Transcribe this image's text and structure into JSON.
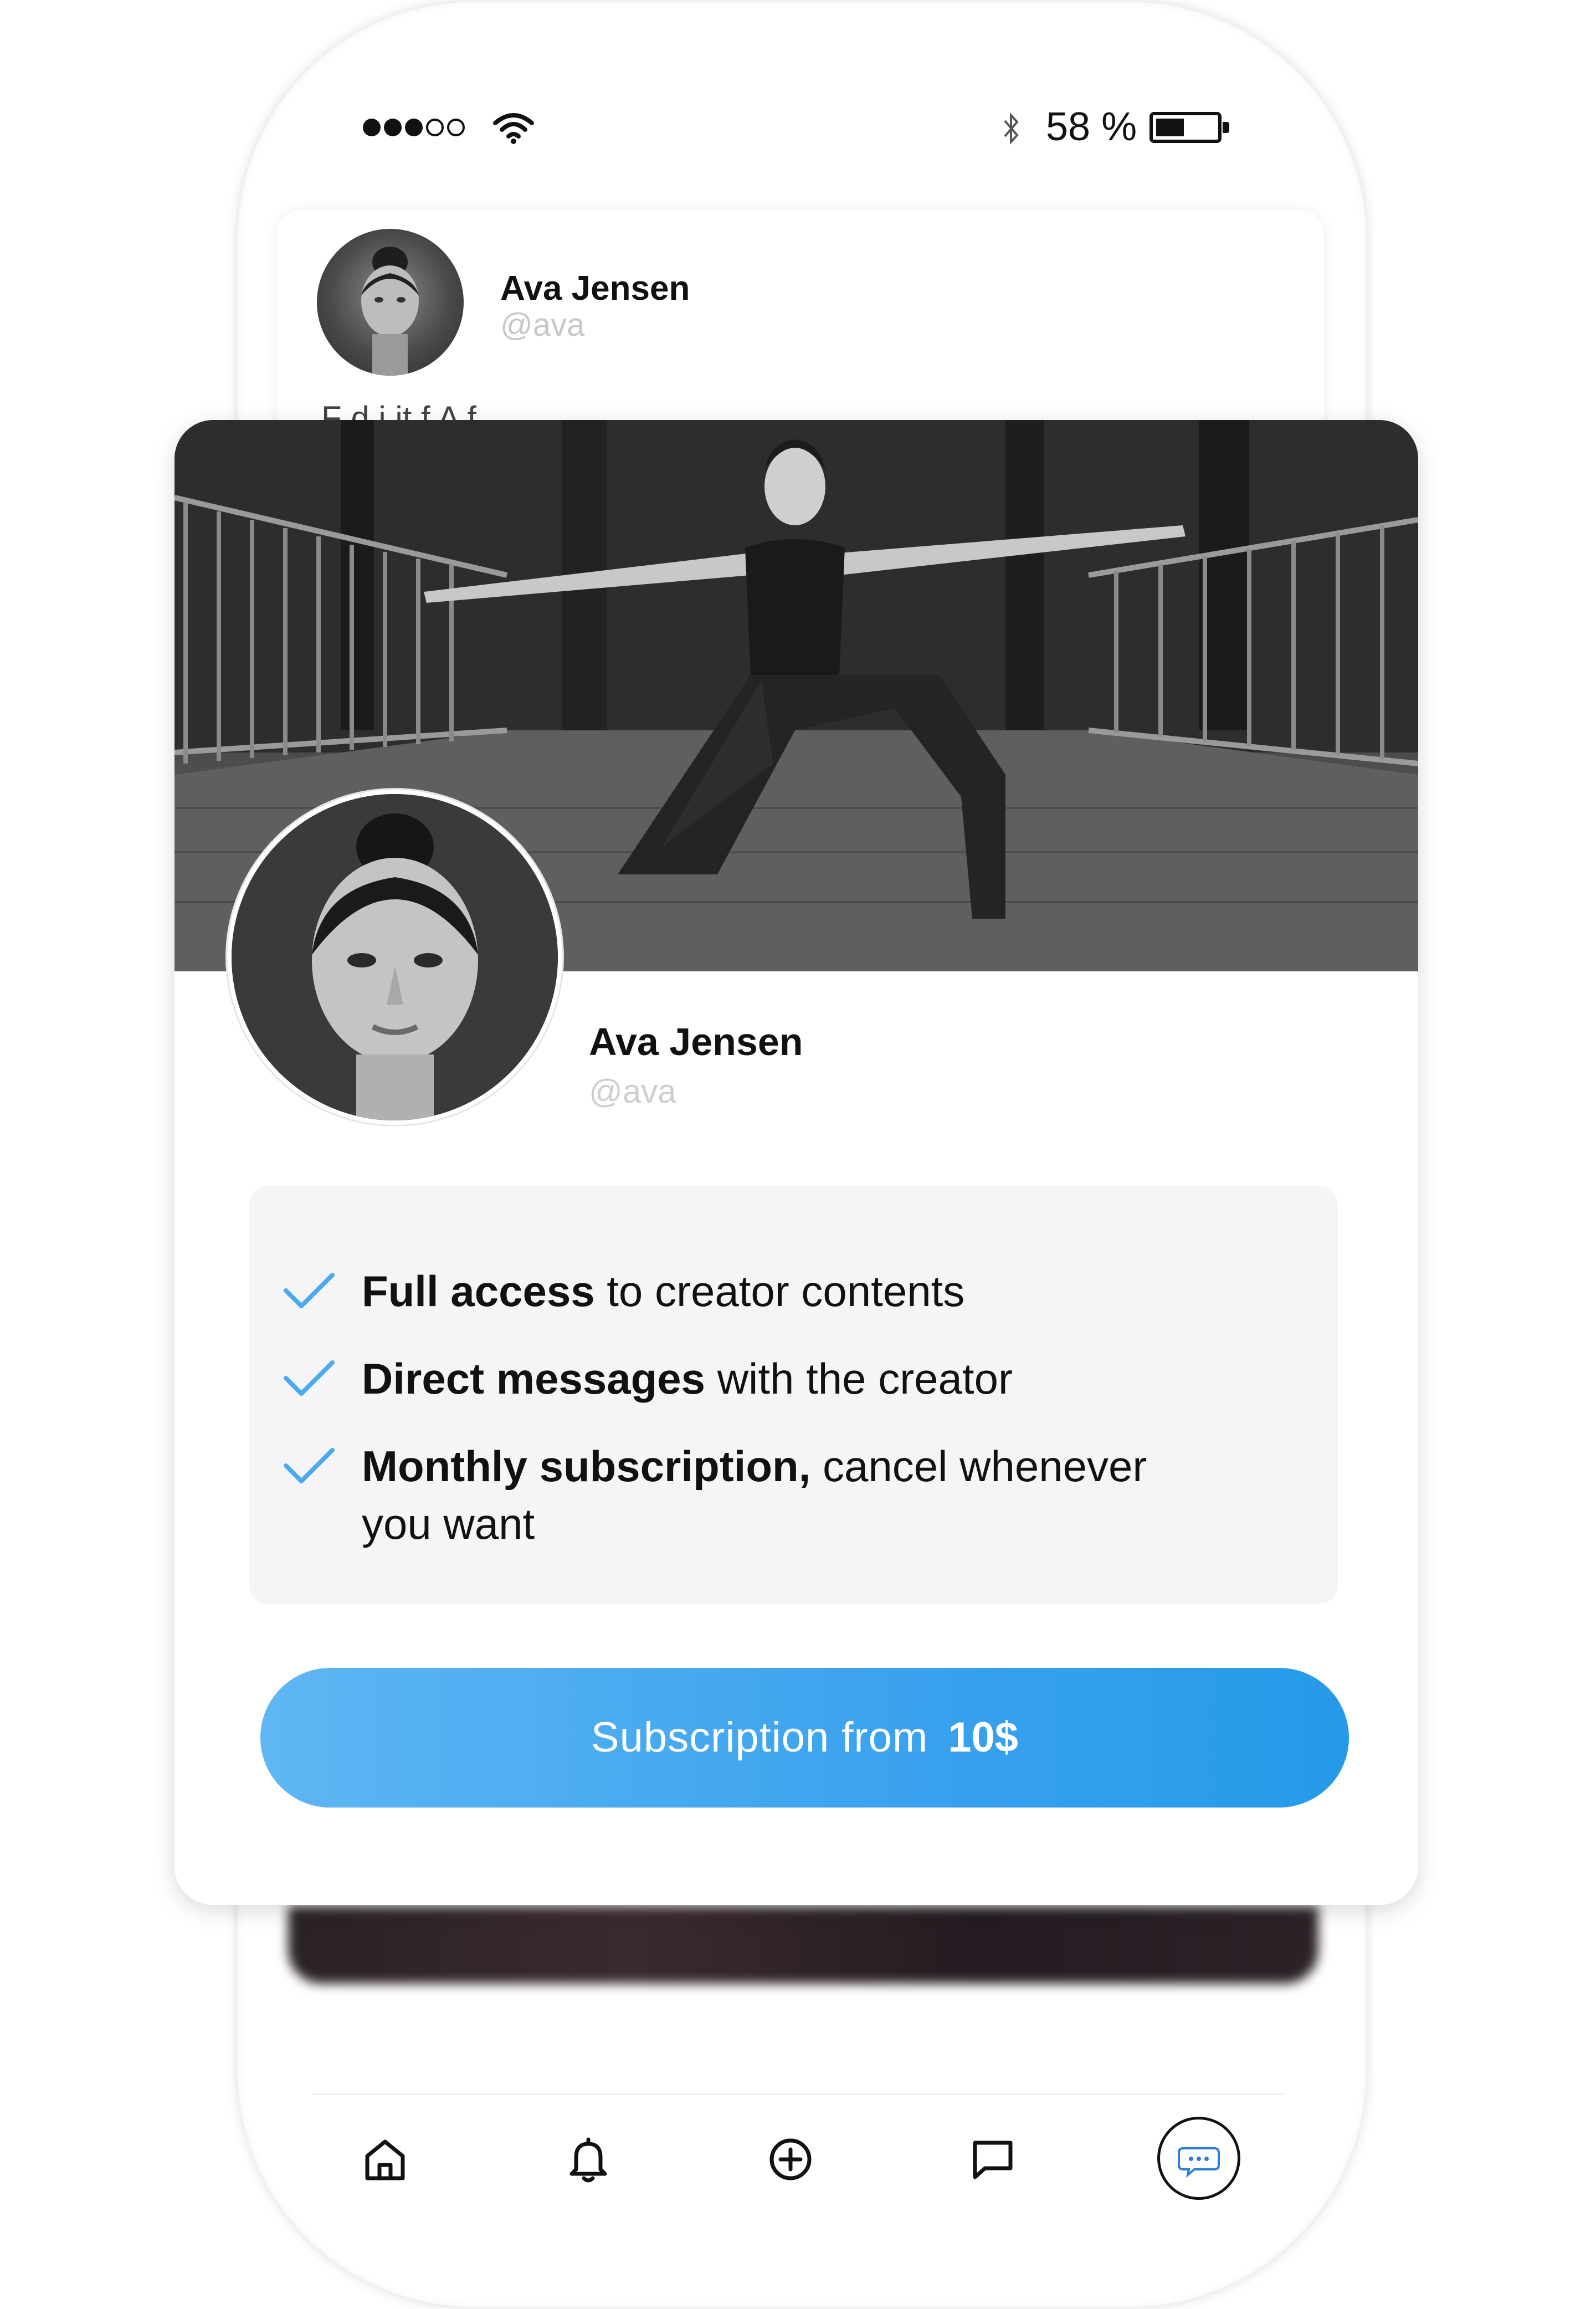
{
  "status_bar": {
    "battery_percent": "58 %",
    "signal_bars_filled": 3,
    "signal_bars_total": 5
  },
  "background_post": {
    "name": "Ava Jensen",
    "handle": "@ava",
    "snippet": "F  d  i it   f  A f"
  },
  "profile": {
    "name": "Ava Jensen",
    "handle": "@ava"
  },
  "features": [
    {
      "bold": "Full access",
      "rest": " to creator contents"
    },
    {
      "bold": "Direct messages",
      "rest": " with the creator"
    },
    {
      "bold": "Monthly subscription,",
      "rest": " cancel whenever you want"
    }
  ],
  "cta": {
    "label": "Subscription from",
    "price": "10$"
  },
  "nav": {
    "items": [
      "home-icon",
      "bell-icon",
      "plus-circle-icon",
      "message-icon",
      "chat-bubbles-icon"
    ],
    "active": "chat-bubbles-icon"
  },
  "colors": {
    "accent": "#3aa2ee",
    "check": "#4aa9ef",
    "text": "#111111",
    "muted": "#cfcfd3",
    "panel": "#f5f5f7"
  }
}
